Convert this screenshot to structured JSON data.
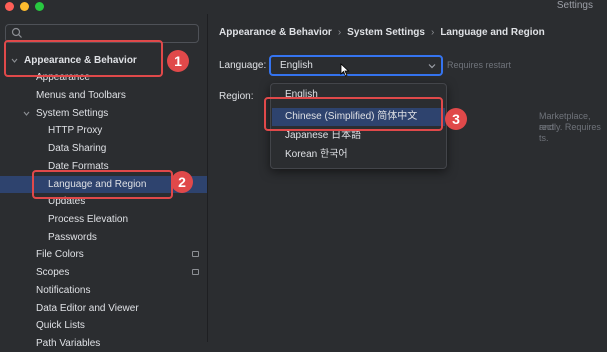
{
  "window": {
    "title": "Settings"
  },
  "search": {
    "placeholder": ""
  },
  "sidebar": {
    "items": [
      {
        "label": "Appearance & Behavior"
      },
      {
        "label": "Appearance"
      },
      {
        "label": "Menus and Toolbars"
      },
      {
        "label": "System Settings"
      },
      {
        "label": "HTTP Proxy"
      },
      {
        "label": "Data Sharing"
      },
      {
        "label": "Date Formats"
      },
      {
        "label": "Language and Region"
      },
      {
        "label": "Updates"
      },
      {
        "label": "Process Elevation"
      },
      {
        "label": "Passwords"
      },
      {
        "label": "File Colors"
      },
      {
        "label": "Scopes"
      },
      {
        "label": "Notifications"
      },
      {
        "label": "Data Editor and Viewer"
      },
      {
        "label": "Quick Lists"
      },
      {
        "label": "Path Variables"
      }
    ]
  },
  "breadcrumb": [
    "Appearance & Behavior",
    "System Settings",
    "Language and Region"
  ],
  "breadcrumb_sep": "›",
  "form": {
    "language_label": "Language:",
    "language_value": "English",
    "requires_restart": "Requires restart",
    "region_label": "Region:",
    "partial_lines": [
      "Marketplace, and",
      "rectly. Requires",
      "ts."
    ]
  },
  "dropdown": {
    "options": [
      "English",
      "Chinese (Simplified) 简体中文",
      "Japanese 日本語",
      "Korean 한국어"
    ],
    "selected": "Chinese (Simplified) 简体中文"
  },
  "callouts": [
    "1",
    "2",
    "3"
  ],
  "colors": {
    "accent": "#3574f0",
    "selection": "#2e436e",
    "callout": "#e0494a",
    "background": "#2b2d30"
  }
}
